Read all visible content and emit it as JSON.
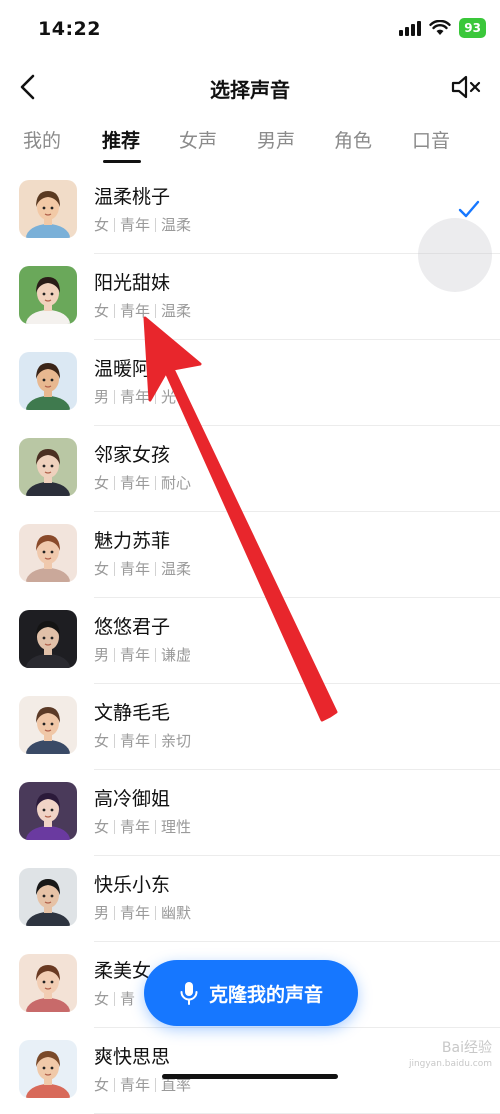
{
  "status_bar": {
    "time": "14:22",
    "battery": "93"
  },
  "nav": {
    "title": "选择声音"
  },
  "tabs": [
    {
      "label": "我的",
      "active": false
    },
    {
      "label": "推荐",
      "active": true
    },
    {
      "label": "女声",
      "active": false
    },
    {
      "label": "男声",
      "active": false
    },
    {
      "label": "角色",
      "active": false
    },
    {
      "label": "口音",
      "active": false
    }
  ],
  "voices": [
    {
      "name": "温柔桃子",
      "tags": [
        "女",
        "青年",
        "温柔"
      ],
      "selected": true,
      "avatar_bg": "#f1dcc8",
      "skin": "#f2c9a6",
      "hair": "#5a3a22",
      "cloth": "#7ab0d8"
    },
    {
      "name": "阳光甜妹",
      "tags": [
        "女",
        "青年",
        "温柔"
      ],
      "selected": false,
      "avatar_bg": "#6aa85a",
      "skin": "#f1d2bd",
      "hair": "#2a1d18",
      "cloth": "#f4f1ee"
    },
    {
      "name": "温暖阿",
      "tags": [
        "男",
        "青年",
        "光"
      ],
      "selected": false,
      "avatar_bg": "#dbe8f3",
      "skin": "#e8b890",
      "hair": "#3a2518",
      "cloth": "#3f7a4e"
    },
    {
      "name": "邻家女孩",
      "tags": [
        "女",
        "青年",
        "耐心"
      ],
      "selected": false,
      "avatar_bg": "#b9c7a4",
      "skin": "#efd1bd",
      "hair": "#4a2f22",
      "cloth": "#2b2f3a"
    },
    {
      "name": "魅力苏菲",
      "tags": [
        "女",
        "青年",
        "温柔"
      ],
      "selected": false,
      "avatar_bg": "#f2e4dc",
      "skin": "#f0c9ad",
      "hair": "#8a4a2a",
      "cloth": "#caa89a"
    },
    {
      "name": "悠悠君子",
      "tags": [
        "男",
        "青年",
        "谦虚"
      ],
      "selected": false,
      "avatar_bg": "#1e1e22",
      "skin": "#e0c0a8",
      "hair": "#141414",
      "cloth": "#2a2a30"
    },
    {
      "name": "文静毛毛",
      "tags": [
        "女",
        "青年",
        "亲切"
      ],
      "selected": false,
      "avatar_bg": "#f3ece6",
      "skin": "#f0c7a7",
      "hair": "#5b3a26",
      "cloth": "#3a4a66"
    },
    {
      "name": "高冷御姐",
      "tags": [
        "女",
        "青年",
        "理性"
      ],
      "selected": false,
      "avatar_bg": "#4a3a5a",
      "skin": "#f0d3c6",
      "hair": "#2b1a3a",
      "cloth": "#6a3aa0"
    },
    {
      "name": "快乐小东",
      "tags": [
        "男",
        "青年",
        "幽默"
      ],
      "selected": false,
      "avatar_bg": "#dfe3e6",
      "skin": "#e6c2a6",
      "hair": "#181818",
      "cloth": "#2e3440"
    },
    {
      "name": "柔美女",
      "tags": [
        "女",
        "青"
      ],
      "selected": false,
      "avatar_bg": "#f3e2d6",
      "skin": "#f2cdb3",
      "hair": "#6a3a22",
      "cloth": "#c86a6a"
    },
    {
      "name": "爽快思思",
      "tags": [
        "女",
        "青年",
        "直率"
      ],
      "selected": false,
      "avatar_bg": "#e8f0f7",
      "skin": "#f0c9a9",
      "hair": "#7a4a2a",
      "cloth": "#d86a5a"
    }
  ],
  "clone_button": {
    "label": "克隆我的声音"
  },
  "watermark": {
    "main": "Bai经验",
    "sub": "jingyan.baidu.com"
  },
  "colors": {
    "accent": "#1677ff",
    "annotation_arrow": "#e8262c"
  }
}
